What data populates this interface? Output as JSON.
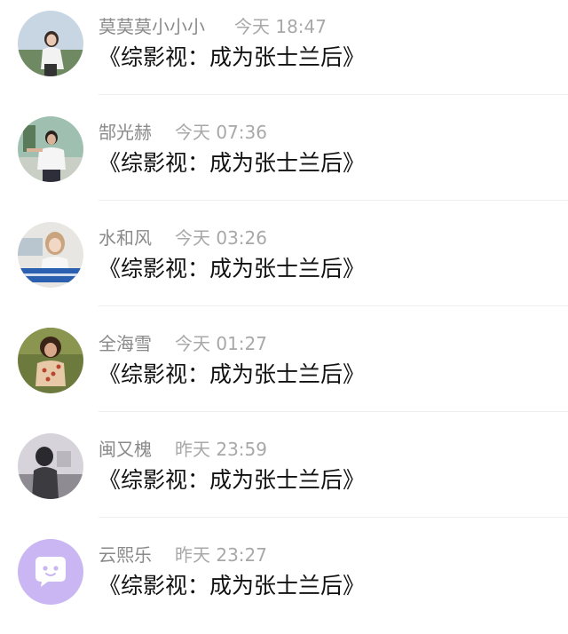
{
  "comments": [
    {
      "name": "莫莫莫小小小",
      "time": "今天 18:47",
      "message": "《综影视：成为张士兰后》",
      "avatar": "photo-girl-outdoor-avatar"
    },
    {
      "name": "郜光赫",
      "time": "今天 07:36",
      "message": "《综影视：成为张士兰后》",
      "avatar": "photo-boy-park-avatar"
    },
    {
      "name": "水和风",
      "time": "今天 03:26",
      "message": "《综影视：成为张士兰后》",
      "avatar": "photo-girl-banner-avatar"
    },
    {
      "name": "全海雪",
      "time": "今天 01:27",
      "message": "《综影视：成为张士兰后》",
      "avatar": "photo-girl-floral-avatar"
    },
    {
      "name": "闽又槐",
      "time": "昨天 23:59",
      "message": "《综影视：成为张士兰后》",
      "avatar": "photo-girl-bw-avatar"
    },
    {
      "name": "云熙乐",
      "time": "昨天 23:27",
      "message": "《综影视：成为张士兰后》",
      "avatar": "default-purple-chat-avatar"
    }
  ],
  "colors": {
    "name": "#8a8a8a",
    "time": "#a8a8a8",
    "message": "#111111",
    "divider": "#efefef",
    "default_avatar": "#c9b6f2"
  }
}
